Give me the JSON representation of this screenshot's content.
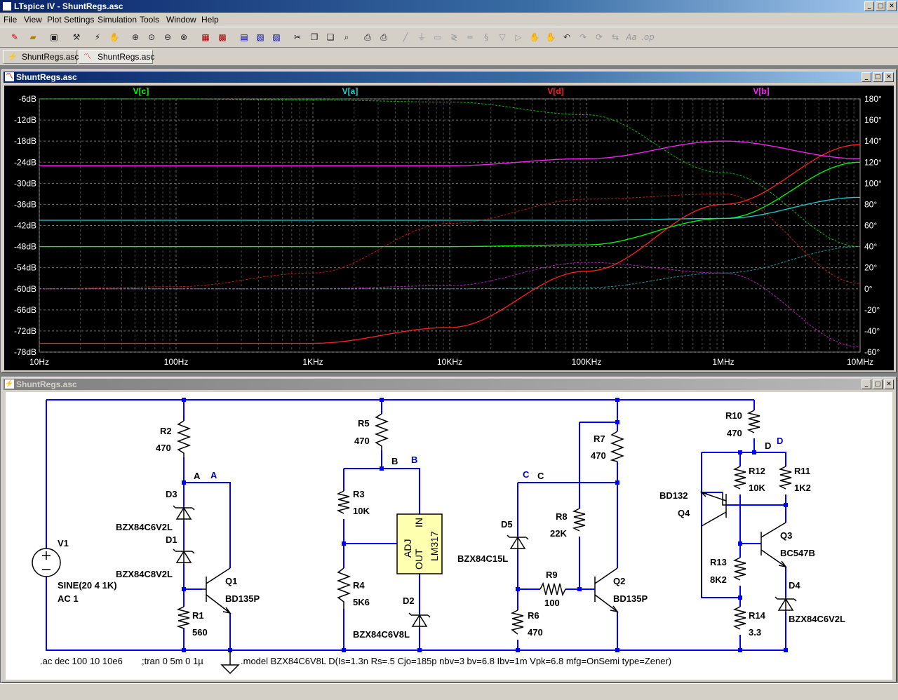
{
  "app": {
    "title": "LTspice IV - ShuntRegs.asc",
    "min": "_",
    "max": "□",
    "close": "✕"
  },
  "menu": [
    "File",
    "View",
    "Plot Settings",
    "Simulation",
    "Tools",
    "Window",
    "Help"
  ],
  "toolbar_icons": [
    "new-schematic-icon",
    "open-icon",
    "save-icon",
    "control-panel-icon",
    "run-icon",
    "halt-icon",
    "zoom-in-icon",
    "zoom-pan-icon",
    "zoom-out-icon",
    "zoom-fit-icon",
    "autorange-icon",
    "zoom-extents-icon",
    "tile-horizontal-icon",
    "cascade-icon",
    "close-window-icon",
    "cut-icon",
    "copy-icon",
    "paste-icon",
    "find-icon",
    "print-setup-icon",
    "print-icon",
    "wire-icon",
    "ground-icon",
    "label-icon",
    "resistor-icon",
    "capacitor-icon",
    "inductor-icon",
    "diode-icon",
    "component-icon",
    "move-icon",
    "drag-icon",
    "undo-icon",
    "redo-icon",
    "rotate-icon",
    "mirror-icon",
    "text-icon",
    "spice-directive-icon"
  ],
  "tabs": [
    {
      "label": "ShuntRegs.asc",
      "icon": "schematic-tab-icon"
    },
    {
      "label": "ShuntRegs.asc",
      "icon": "plot-tab-icon"
    }
  ],
  "plot_window": {
    "title": "ShuntRegs.asc",
    "legend": [
      {
        "label": "V[c]",
        "color": "#00ff00"
      },
      {
        "label": "V[a]",
        "color": "#1fd0d0"
      },
      {
        "label": "V[d]",
        "color": "#ff2020"
      },
      {
        "label": "V[b]",
        "color": "#ff20ff"
      }
    ],
    "y_left_ticks": [
      "-6dB",
      "-12dB",
      "-18dB",
      "-24dB",
      "-30dB",
      "-36dB",
      "-42dB",
      "-48dB",
      "-54dB",
      "-60dB",
      "-66dB",
      "-72dB",
      "-78dB"
    ],
    "y_right_ticks": [
      "180°",
      "160°",
      "140°",
      "120°",
      "100°",
      "80°",
      "60°",
      "40°",
      "20°",
      "0°",
      "-20°",
      "-40°",
      "-60°"
    ],
    "x_ticks": [
      "10Hz",
      "100Hz",
      "1KHz",
      "10KHz",
      "100KHz",
      "1MHz",
      "10MHz"
    ]
  },
  "chart_data": {
    "type": "line",
    "x_scale": "log",
    "xlim": [
      10,
      10000000
    ],
    "ylim_left_db": [
      -78,
      -6
    ],
    "ylim_right_deg": [
      -60,
      180
    ],
    "grid": true,
    "legend_placement": "top",
    "x": [
      10,
      100,
      1000,
      10000,
      100000,
      1000000,
      10000000
    ],
    "series": [
      {
        "name": "V[c]",
        "color": "#00ff00",
        "magnitude_db": [
          -48,
          -48,
          -48,
          -48,
          -47.5,
          -40,
          -24
        ],
        "phase_deg": [
          180,
          180,
          179,
          177,
          165,
          110,
          40
        ]
      },
      {
        "name": "V[a]",
        "color": "#1fd0d0",
        "magnitude_db": [
          -40.5,
          -40.5,
          -40.5,
          -40.5,
          -40.5,
          -40,
          -34
        ],
        "phase_deg": [
          0,
          0,
          0,
          0,
          1,
          15,
          40
        ]
      },
      {
        "name": "V[d]",
        "color": "#ff2020",
        "magnitude_db": [
          -75.5,
          -75.5,
          -75.5,
          -71,
          -55,
          -36,
          -19
        ],
        "phase_deg": [
          0,
          2,
          15,
          62,
          85,
          90,
          5
        ]
      },
      {
        "name": "V[b]",
        "color": "#ff20ff",
        "magnitude_db": [
          -25,
          -25,
          -25,
          -25,
          -23,
          -18,
          -23
        ],
        "phase_deg": [
          0,
          0,
          0,
          3,
          25,
          15,
          -55
        ]
      }
    ]
  },
  "schematic_window": {
    "title": "ShuntRegs.asc",
    "labels": {
      "R2": "R2",
      "R2v": "470",
      "A": "A",
      "D3": "D3",
      "D3v": "BZX84C6V2L",
      "D1": "D1",
      "D1v": "BZX84C8V2L",
      "Q1": "Q1",
      "Q1v": "BD135P",
      "R1": "R1",
      "R1v": "560",
      "V1": "V1",
      "V1a": "SINE(20 4 1K)",
      "V1b": "AC 1",
      "R5": "R5",
      "R5v": "470",
      "B": "B",
      "R3": "R3",
      "R3v": "10K",
      "R4": "R4",
      "R4v": "5K6",
      "D2": "D2",
      "D2v": "BZX84C6V8L",
      "U1a": "ADJ",
      "U1b": "OUT",
      "U1c": "IN",
      "U1d": "LM317",
      "C": "C",
      "D5": "D5",
      "D5v": "BZX84C15L",
      "R7": "R7",
      "R7v": "470",
      "R8": "R8",
      "R8v": "22K",
      "R9": "R9",
      "R9v": "100",
      "R6": "R6",
      "R6v": "470",
      "Q2": "Q2",
      "Q2v": "BD135P",
      "R10": "R10",
      "R10v": "470",
      "D": "D",
      "R12": "R12",
      "R12v": "10K",
      "R11": "R11",
      "R11v": "1K2",
      "BD132": "BD132",
      "Q4": "Q4",
      "Q3": "Q3",
      "Q3v": "BC547B",
      "R13": "R13",
      "R13v": "8K2",
      "R14": "R14",
      "R14v": "3.3",
      "D4": "D4",
      "D4v": "BZX84C6V2L"
    },
    "directive_ac": ".ac dec 100 10 10e6",
    "directive_tran": ";tran 0 5m 0 1µ",
    "directive_model": ".model BZX84C6V8L D(Is=1.3n Rs=.5 Cjo=185p nbv=3 bv=6.8 Ibv=1m Vpk=6.8 mfg=OnSemi type=Zener)"
  },
  "colors": {
    "wire": "#0000ff",
    "component": "#000000",
    "node": "#0000ff",
    "label_blue": "#0000cc"
  }
}
